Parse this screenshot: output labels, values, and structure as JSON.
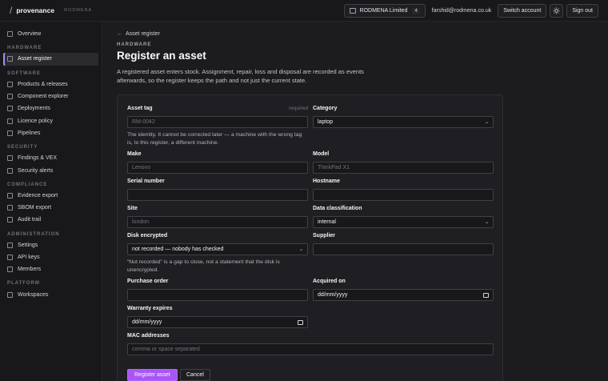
{
  "header": {
    "slash": "/",
    "brand": "provenance",
    "org_tag": "RODMENA",
    "org_button": "RODMENA Limited",
    "org_count": "4",
    "email": "farshid@rodmena.co.uk",
    "switch_account": "Switch account",
    "sign_out": "Sign out"
  },
  "sidebar": {
    "overview": "Overview",
    "sections": {
      "hardware": "HARDWARE",
      "software": "SOFTWARE",
      "security": "SECURITY",
      "compliance": "COMPLIANCE",
      "administration": "ADMINISTRATION",
      "platform": "PLATFORM"
    },
    "items": {
      "asset_register": "Asset register",
      "products": "Products & releases",
      "component_explorer": "Component explorer",
      "deployments": "Deployments",
      "licence_policy": "Licence policy",
      "pipelines": "Pipelines",
      "findings": "Findings & VEX",
      "security_alerts": "Security alerts",
      "evidence_export": "Evidence export",
      "sbom_export": "SBOM export",
      "audit_trail": "Audit trail",
      "settings": "Settings",
      "api_keys": "API keys",
      "members": "Members",
      "workspaces": "Workspaces"
    }
  },
  "page": {
    "back_link": "Asset register",
    "eyebrow": "HARDWARE",
    "title": "Register an asset",
    "intro": "A registered asset enters stock. Assignment, repair, loss and disposal are recorded as events afterwards, so the register keeps the path and not just the current state."
  },
  "form": {
    "asset_tag": {
      "label": "Asset tag",
      "required": "required",
      "placeholder": "RM-0042",
      "help": "The identity. It cannot be corrected later — a machine with the wrong tag is, to this register, a different machine."
    },
    "category": {
      "label": "Category",
      "value": "laptop"
    },
    "make": {
      "label": "Make",
      "placeholder": "Lenovo"
    },
    "model": {
      "label": "Model",
      "placeholder": "ThinkPad X1"
    },
    "serial_number": {
      "label": "Serial number",
      "placeholder": ""
    },
    "hostname": {
      "label": "Hostname",
      "placeholder": ""
    },
    "site": {
      "label": "Site",
      "placeholder": "london"
    },
    "data_classification": {
      "label": "Data classification",
      "value": "internal"
    },
    "disk_encrypted": {
      "label": "Disk encrypted",
      "value": "not recorded — nobody has checked",
      "help": "“Not recorded” is a gap to close, not a statement that the disk is unencrypted."
    },
    "supplier": {
      "label": "Supplier",
      "placeholder": ""
    },
    "purchase_order": {
      "label": "Purchase order",
      "placeholder": ""
    },
    "acquired_on": {
      "label": "Acquired on",
      "value": "dd/mm/yyyy"
    },
    "warranty_expires": {
      "label": "Warranty expires",
      "value": "dd/mm/yyyy"
    },
    "mac_addresses": {
      "label": "MAC addresses",
      "placeholder": "comma or space separated"
    },
    "submit": "Register asset",
    "cancel": "Cancel"
  }
}
